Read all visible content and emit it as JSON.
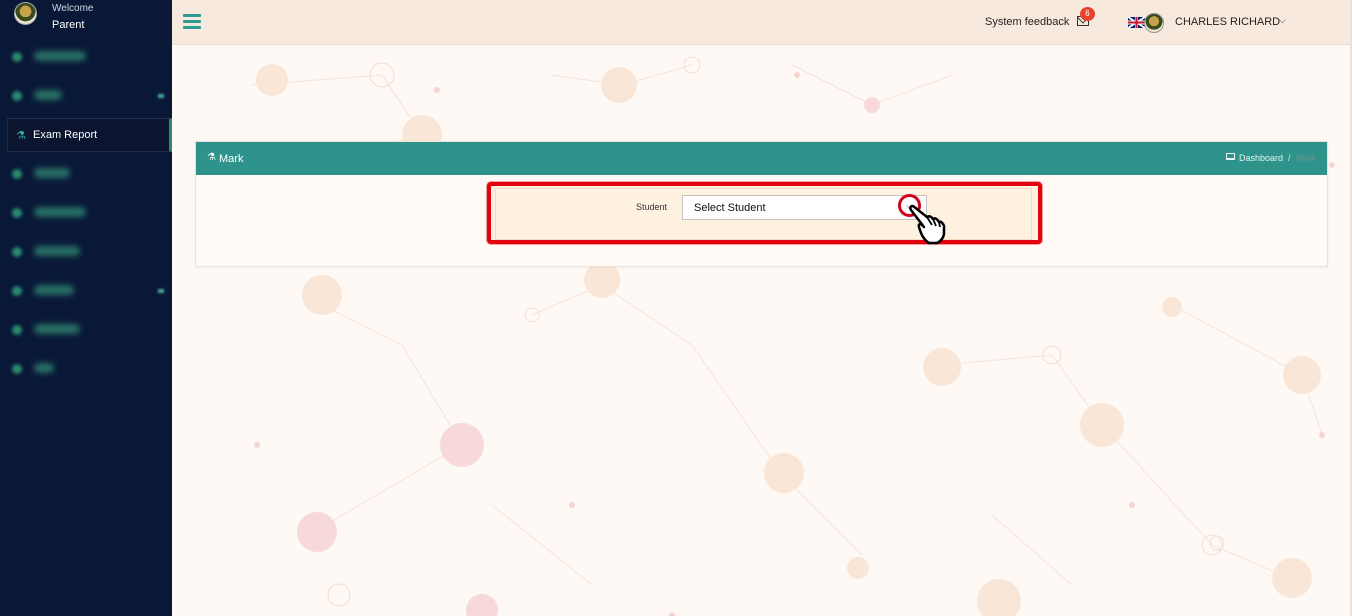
{
  "sidebar": {
    "welcome": "Welcome",
    "role": "Parent",
    "active_item": "Exam Report",
    "active_icon": "flask-icon"
  },
  "header": {
    "feedback_label": "System feedback",
    "mail_badge": "6",
    "user_name": "CHARLES RICHARD"
  },
  "panel": {
    "title": "Mark",
    "breadcrumb_home": "Dashboard",
    "breadcrumb_sep": "/",
    "breadcrumb_current": "Mark"
  },
  "form": {
    "student_label": "Student",
    "student_select": "Select Student"
  },
  "colors": {
    "sidebar_bg": "#0a1838",
    "accent": "#2e948b",
    "highlight_border": "#e3000f",
    "header_bg": "#f8e9de"
  }
}
